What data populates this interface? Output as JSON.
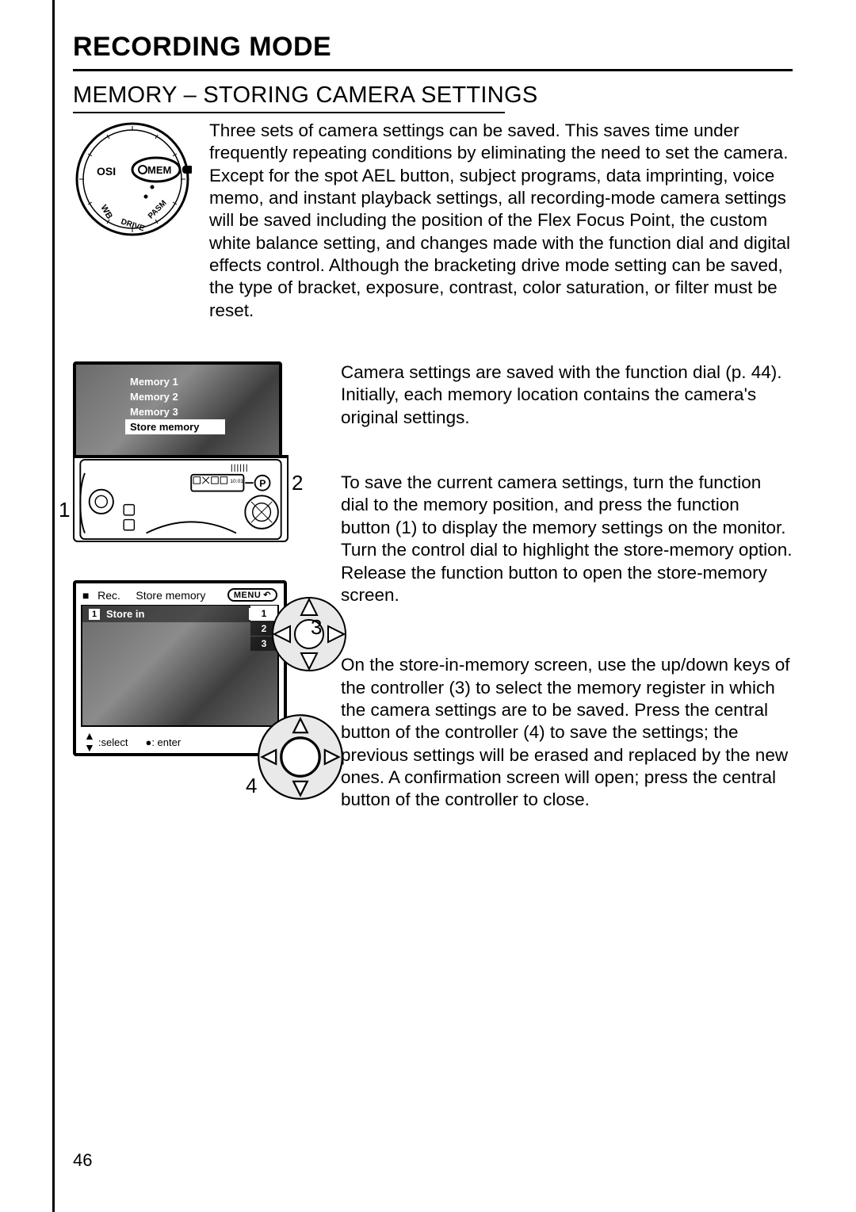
{
  "header": {
    "title": "RECORDING MODE",
    "subtitle": "MEMORY – STORING CAMERA SETTINGS"
  },
  "dial": {
    "labels": {
      "osi": "OSI",
      "mem": "MEM",
      "wb": "WB",
      "drive": "DRIVE",
      "pasm": "PASM"
    }
  },
  "intro": "Three sets of camera settings can be saved. This saves time under frequently repeating conditions by eliminating the need to set the camera. Except for the spot AEL button, subject programs, data imprinting, voice memo, and instant playback settings, all recording-mode camera settings will be saved including the position of the Flex Focus Point, the custom white balance setting, and changes made with the function dial and digital effects control. Although the bracketing drive mode setting can be saved, the type of bracket, exposure, contrast, color saturation, or filter must be reset.",
  "para_overview": "Camera settings are saved with the function dial (p. 44). Initially, each memory location contains the camera's original settings.",
  "para_save": "To save the current camera settings, turn the function dial to the memory position, and press the function button (1) to display the memory settings on the monitor. Turn the control dial to highlight the store-memory option. Release the function button to open the store-memory screen.",
  "para_store": "On the store-in-memory screen, use the up/down keys of the controller (3) to select the memory register in which the camera settings are to be saved. Press the central button of the controller (4) to save the settings; the previous settings will be erased and replaced by the new ones. A confirmation screen will open; press the central button of the controller to close.",
  "diagram1": {
    "menu": [
      "Memory  1",
      "Memory  2",
      "Memory  3",
      "Store memory"
    ],
    "selected_index": 3,
    "callouts": {
      "one": "1",
      "two": "2"
    },
    "lcd_mode": "P"
  },
  "diagram2": {
    "topbar": {
      "mode": "Rec.",
      "title": "Store memory",
      "menu_label": "MENU"
    },
    "row": {
      "badge": "1",
      "label": "Store in"
    },
    "options": [
      "1",
      "2",
      "3"
    ],
    "selected_option": 0,
    "footer": {
      "select": "select",
      "enter": "enter"
    },
    "callouts": {
      "three": "3",
      "four": "4"
    }
  },
  "page_number": "46"
}
